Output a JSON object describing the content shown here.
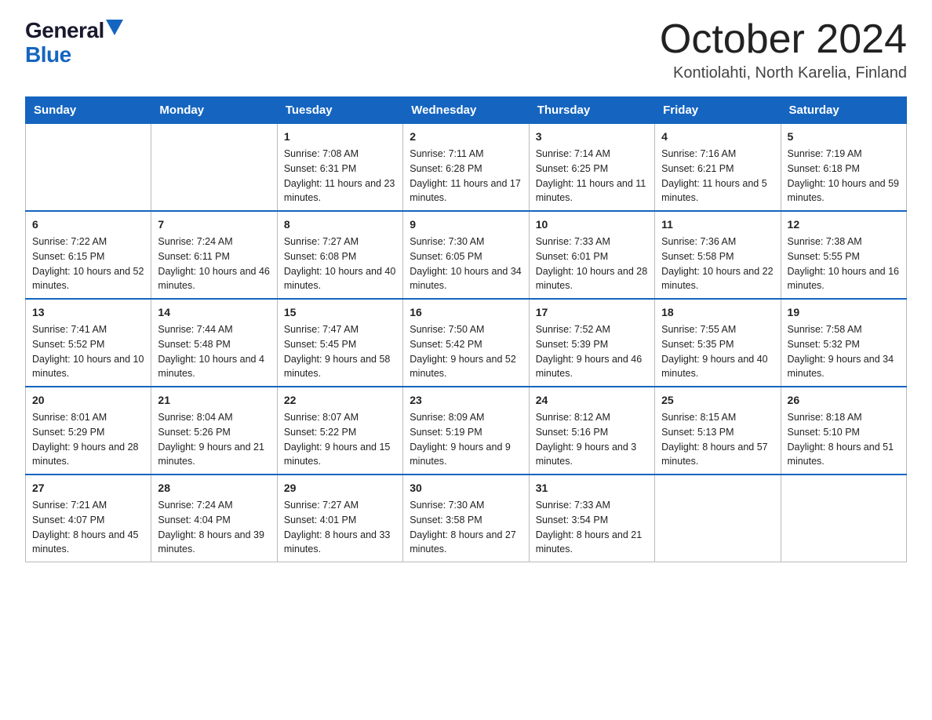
{
  "logo": {
    "general": "General",
    "blue": "Blue"
  },
  "title": "October 2024",
  "location": "Kontiolahti, North Karelia, Finland",
  "weekdays": [
    "Sunday",
    "Monday",
    "Tuesday",
    "Wednesday",
    "Thursday",
    "Friday",
    "Saturday"
  ],
  "weeks": [
    [
      {
        "day": "",
        "sunrise": "",
        "sunset": "",
        "daylight": ""
      },
      {
        "day": "",
        "sunrise": "",
        "sunset": "",
        "daylight": ""
      },
      {
        "day": "1",
        "sunrise": "Sunrise: 7:08 AM",
        "sunset": "Sunset: 6:31 PM",
        "daylight": "Daylight: 11 hours and 23 minutes."
      },
      {
        "day": "2",
        "sunrise": "Sunrise: 7:11 AM",
        "sunset": "Sunset: 6:28 PM",
        "daylight": "Daylight: 11 hours and 17 minutes."
      },
      {
        "day": "3",
        "sunrise": "Sunrise: 7:14 AM",
        "sunset": "Sunset: 6:25 PM",
        "daylight": "Daylight: 11 hours and 11 minutes."
      },
      {
        "day": "4",
        "sunrise": "Sunrise: 7:16 AM",
        "sunset": "Sunset: 6:21 PM",
        "daylight": "Daylight: 11 hours and 5 minutes."
      },
      {
        "day": "5",
        "sunrise": "Sunrise: 7:19 AM",
        "sunset": "Sunset: 6:18 PM",
        "daylight": "Daylight: 10 hours and 59 minutes."
      }
    ],
    [
      {
        "day": "6",
        "sunrise": "Sunrise: 7:22 AM",
        "sunset": "Sunset: 6:15 PM",
        "daylight": "Daylight: 10 hours and 52 minutes."
      },
      {
        "day": "7",
        "sunrise": "Sunrise: 7:24 AM",
        "sunset": "Sunset: 6:11 PM",
        "daylight": "Daylight: 10 hours and 46 minutes."
      },
      {
        "day": "8",
        "sunrise": "Sunrise: 7:27 AM",
        "sunset": "Sunset: 6:08 PM",
        "daylight": "Daylight: 10 hours and 40 minutes."
      },
      {
        "day": "9",
        "sunrise": "Sunrise: 7:30 AM",
        "sunset": "Sunset: 6:05 PM",
        "daylight": "Daylight: 10 hours and 34 minutes."
      },
      {
        "day": "10",
        "sunrise": "Sunrise: 7:33 AM",
        "sunset": "Sunset: 6:01 PM",
        "daylight": "Daylight: 10 hours and 28 minutes."
      },
      {
        "day": "11",
        "sunrise": "Sunrise: 7:36 AM",
        "sunset": "Sunset: 5:58 PM",
        "daylight": "Daylight: 10 hours and 22 minutes."
      },
      {
        "day": "12",
        "sunrise": "Sunrise: 7:38 AM",
        "sunset": "Sunset: 5:55 PM",
        "daylight": "Daylight: 10 hours and 16 minutes."
      }
    ],
    [
      {
        "day": "13",
        "sunrise": "Sunrise: 7:41 AM",
        "sunset": "Sunset: 5:52 PM",
        "daylight": "Daylight: 10 hours and 10 minutes."
      },
      {
        "day": "14",
        "sunrise": "Sunrise: 7:44 AM",
        "sunset": "Sunset: 5:48 PM",
        "daylight": "Daylight: 10 hours and 4 minutes."
      },
      {
        "day": "15",
        "sunrise": "Sunrise: 7:47 AM",
        "sunset": "Sunset: 5:45 PM",
        "daylight": "Daylight: 9 hours and 58 minutes."
      },
      {
        "day": "16",
        "sunrise": "Sunrise: 7:50 AM",
        "sunset": "Sunset: 5:42 PM",
        "daylight": "Daylight: 9 hours and 52 minutes."
      },
      {
        "day": "17",
        "sunrise": "Sunrise: 7:52 AM",
        "sunset": "Sunset: 5:39 PM",
        "daylight": "Daylight: 9 hours and 46 minutes."
      },
      {
        "day": "18",
        "sunrise": "Sunrise: 7:55 AM",
        "sunset": "Sunset: 5:35 PM",
        "daylight": "Daylight: 9 hours and 40 minutes."
      },
      {
        "day": "19",
        "sunrise": "Sunrise: 7:58 AM",
        "sunset": "Sunset: 5:32 PM",
        "daylight": "Daylight: 9 hours and 34 minutes."
      }
    ],
    [
      {
        "day": "20",
        "sunrise": "Sunrise: 8:01 AM",
        "sunset": "Sunset: 5:29 PM",
        "daylight": "Daylight: 9 hours and 28 minutes."
      },
      {
        "day": "21",
        "sunrise": "Sunrise: 8:04 AM",
        "sunset": "Sunset: 5:26 PM",
        "daylight": "Daylight: 9 hours and 21 minutes."
      },
      {
        "day": "22",
        "sunrise": "Sunrise: 8:07 AM",
        "sunset": "Sunset: 5:22 PM",
        "daylight": "Daylight: 9 hours and 15 minutes."
      },
      {
        "day": "23",
        "sunrise": "Sunrise: 8:09 AM",
        "sunset": "Sunset: 5:19 PM",
        "daylight": "Daylight: 9 hours and 9 minutes."
      },
      {
        "day": "24",
        "sunrise": "Sunrise: 8:12 AM",
        "sunset": "Sunset: 5:16 PM",
        "daylight": "Daylight: 9 hours and 3 minutes."
      },
      {
        "day": "25",
        "sunrise": "Sunrise: 8:15 AM",
        "sunset": "Sunset: 5:13 PM",
        "daylight": "Daylight: 8 hours and 57 minutes."
      },
      {
        "day": "26",
        "sunrise": "Sunrise: 8:18 AM",
        "sunset": "Sunset: 5:10 PM",
        "daylight": "Daylight: 8 hours and 51 minutes."
      }
    ],
    [
      {
        "day": "27",
        "sunrise": "Sunrise: 7:21 AM",
        "sunset": "Sunset: 4:07 PM",
        "daylight": "Daylight: 8 hours and 45 minutes."
      },
      {
        "day": "28",
        "sunrise": "Sunrise: 7:24 AM",
        "sunset": "Sunset: 4:04 PM",
        "daylight": "Daylight: 8 hours and 39 minutes."
      },
      {
        "day": "29",
        "sunrise": "Sunrise: 7:27 AM",
        "sunset": "Sunset: 4:01 PM",
        "daylight": "Daylight: 8 hours and 33 minutes."
      },
      {
        "day": "30",
        "sunrise": "Sunrise: 7:30 AM",
        "sunset": "Sunset: 3:58 PM",
        "daylight": "Daylight: 8 hours and 27 minutes."
      },
      {
        "day": "31",
        "sunrise": "Sunrise: 7:33 AM",
        "sunset": "Sunset: 3:54 PM",
        "daylight": "Daylight: 8 hours and 21 minutes."
      },
      {
        "day": "",
        "sunrise": "",
        "sunset": "",
        "daylight": ""
      },
      {
        "day": "",
        "sunrise": "",
        "sunset": "",
        "daylight": ""
      }
    ]
  ]
}
